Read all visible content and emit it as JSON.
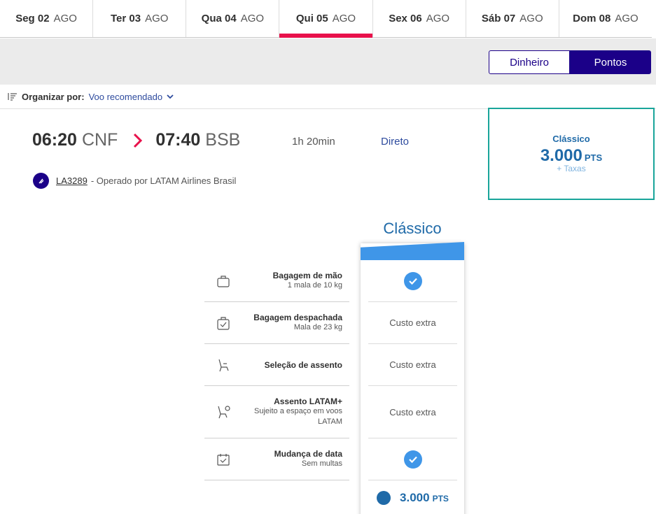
{
  "date_tabs": [
    {
      "day": "Seg 02",
      "month": "AGO"
    },
    {
      "day": "Ter 03",
      "month": "AGO"
    },
    {
      "day": "Qua 04",
      "month": "AGO"
    },
    {
      "day": "Qui 05",
      "month": "AGO",
      "active": true
    },
    {
      "day": "Sex 06",
      "month": "AGO"
    },
    {
      "day": "Sáb 07",
      "month": "AGO"
    },
    {
      "day": "Dom 08",
      "month": "AGO"
    }
  ],
  "payment_toggle": {
    "money": "Dinheiro",
    "points": "Pontos",
    "selected": "points"
  },
  "sort": {
    "label": "Organizar por:",
    "value": "Voo recomendado"
  },
  "flight": {
    "departure_time": "06:20",
    "departure_code": "CNF",
    "arrival_time": "07:40",
    "arrival_code": "BSB",
    "duration": "1h 20min",
    "stops": "Direto",
    "flight_number": "LA3289",
    "operated_by": "- Operado por LATAM Airlines Brasil"
  },
  "fare_card": {
    "family": "Clássico",
    "amount": "3.000",
    "unit": "PTS",
    "taxes": "+ Taxas"
  },
  "family_title": "Clássico",
  "benefits": [
    {
      "title": "Bagagem de mão",
      "subtitle": "1 mala de 10 kg",
      "icon": "hand-baggage-icon",
      "value": "check"
    },
    {
      "title": "Bagagem despachada",
      "subtitle": "Mala de 23 kg",
      "icon": "checked-baggage-icon",
      "value": "Custo extra"
    },
    {
      "title": "Seleção de assento",
      "subtitle": "",
      "icon": "seat-icon",
      "value": "Custo extra"
    },
    {
      "title": "Assento LATAM+",
      "subtitle": "Sujeito a espaço em voos LATAM",
      "icon": "seat-plus-icon",
      "value": "Custo extra"
    },
    {
      "title": "Mudança de data",
      "subtitle": "Sem multas",
      "icon": "calendar-icon",
      "value": "check"
    }
  ],
  "bottom_price": {
    "amount": "3.000",
    "unit": "PTS"
  },
  "colors": {
    "brand": "#1b0088",
    "accent_red": "#e8114b",
    "fare_blue": "#1f6aa8",
    "teal": "#19a59a",
    "check_blue": "#3f96e8"
  }
}
